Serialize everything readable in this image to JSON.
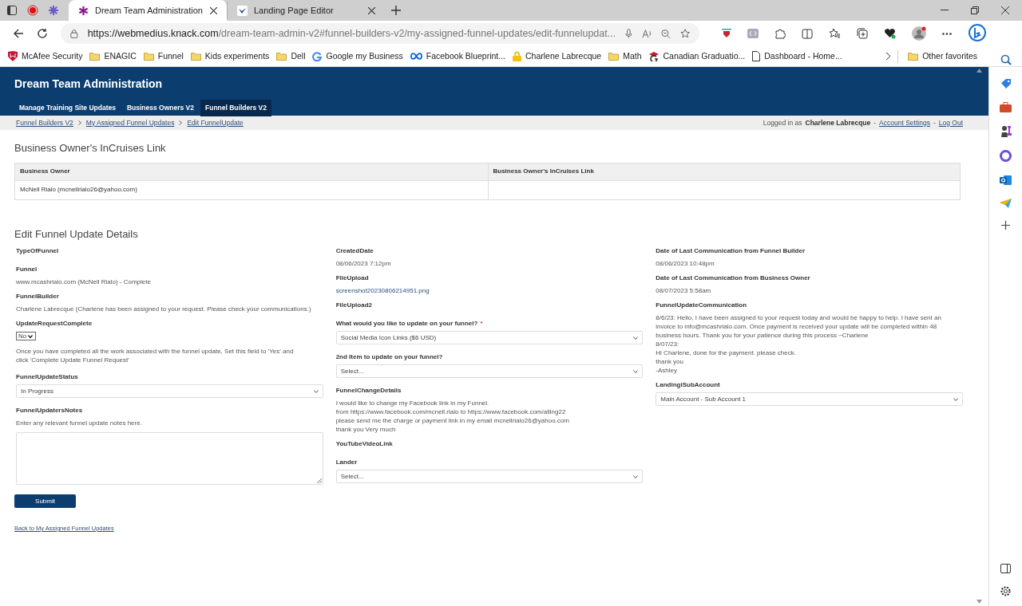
{
  "browser": {
    "tabs": [
      {
        "label": "Dream Team Administration",
        "selected": true
      },
      {
        "label": "Landing Page Editor",
        "selected": false
      }
    ],
    "url_host": "https://webmedius.knack.com",
    "url_path": "/dream-team-admin-v2#funnel-builders-v2/my-assigned-funnel-updates/edit-funnelupdat...",
    "bookmarks": [
      {
        "label": "McAfee Security",
        "kind": "shield"
      },
      {
        "label": "ENAGIC",
        "kind": "folder"
      },
      {
        "label": "Funnel",
        "kind": "folder"
      },
      {
        "label": "Kids experiments",
        "kind": "folder"
      },
      {
        "label": "Dell",
        "kind": "folder"
      },
      {
        "label": "Google my Business",
        "kind": "google"
      },
      {
        "label": "Facebook Blueprint...",
        "kind": "meta"
      },
      {
        "label": "Charlene Labrecque",
        "kind": "lock"
      },
      {
        "label": "Math",
        "kind": "folder"
      },
      {
        "label": "Canadian Graduatio...",
        "kind": "cap"
      },
      {
        "label": "Dashboard - Home...",
        "kind": "page"
      }
    ],
    "other_favorites": "Other favorites"
  },
  "app": {
    "title": "Dream Team Administration",
    "nav": [
      {
        "label": "Manage Training Site Updates",
        "selected": false
      },
      {
        "label": "Business Owners V2",
        "selected": false
      },
      {
        "label": "Funnel Builders V2",
        "selected": true
      }
    ],
    "breadcrumbs": [
      "Funnel Builders V2",
      "My Assigned Funnel Updates",
      "Edit FunnelUpdate"
    ],
    "login": {
      "prefix": "Logged in as",
      "user": "Charlene Labrecque",
      "separator": "-",
      "links": [
        "Account Settings",
        "Log Out"
      ]
    }
  },
  "owner_section": {
    "title": "Business Owner's InCruises Link",
    "columns": [
      "Business Owner",
      "Business Owner's InCruises Link"
    ],
    "rows": [
      [
        "McNell Rialo (mcnellrialo26@yahoo.com)"
      ]
    ]
  },
  "form": {
    "title": "Edit Funnel Update Details",
    "columns": [
      [
        {
          "kind": "label",
          "label": "TypeOfFunnel"
        },
        {
          "kind": "text",
          "label": "Funnel",
          "value": "www.mcashrialo.com (McNell Rialo) - Complete"
        },
        {
          "kind": "text",
          "label": "FunnelBuilder",
          "value": "Charlene Labrecque (Charlene has been assigned to your request. Please check your communications.)"
        },
        {
          "kind": "small-select",
          "label": "UpdateRequestComplete",
          "value": "No",
          "hint": "Once you have completed all the work associated with the funnel update, Set this field to 'Yes' and click 'Complete Update Funnel Request'"
        },
        {
          "kind": "select",
          "label": "FunnelUpdateStatus",
          "value": "In Progress"
        },
        {
          "kind": "textarea",
          "label": "FunnelUpdatersNotes",
          "hint": "Enter any relevant funnel update notes here."
        }
      ],
      [
        {
          "kind": "text",
          "label": "CreatedDate",
          "value": "08/06/2023 7:12pm"
        },
        {
          "kind": "link",
          "label": "FileUpload",
          "value": "screenshot20230806214951.png"
        },
        {
          "kind": "label",
          "label": "FileUpload2"
        },
        {
          "kind": "select",
          "label": "What would you like to update on your funnel?",
          "required": true,
          "value": "Social Media Icon Links ($6 USD)"
        },
        {
          "kind": "select",
          "label": "2nd Item to update on your funnel?",
          "value": "Select..."
        },
        {
          "kind": "lines",
          "label": "FunnelChangeDetails",
          "lines": [
            "I would like to change my Facebook link in my Funnel.",
            "from https://www.facebook.com/mcnell.rialo to https://www.facebook.com/alling22",
            "please send me the charge or payment link in my email mcnellrialo26@yahoo.com",
            "thank you Very much"
          ]
        },
        {
          "kind": "label",
          "label": "YouTubeVideoLink"
        },
        {
          "kind": "select",
          "label": "Lander",
          "value": "Select..."
        }
      ],
      [
        {
          "kind": "text",
          "label": "Date of Last Communication from Funnel Builder",
          "value": "08/06/2023 10:48pm"
        },
        {
          "kind": "text",
          "label": "Date of Last Communication from Business Owner",
          "value": "08/07/2023 5:58am"
        },
        {
          "kind": "lines",
          "label": "FunnelUpdateCommunication",
          "lines": [
            "8/6/23: Hello, I have been assigned to your request today and would be happy to help. I have sent an invoice to info@mcashrialo.com. Once payment is received your update will be completed within 48 business hours. Thank you for your patience during this process ~Charlene",
            "8/07/23:",
            "Hi Charlene, done for the payment. please check.",
            "thank you",
            "-Ashley"
          ]
        },
        {
          "kind": "select",
          "label": "LandingiSubAccount",
          "value": "Main Account - Sub Account 1"
        }
      ]
    ],
    "required_mark": "*",
    "submit": "Submit",
    "back_link": "Back to My Assigned Funnel Updates"
  }
}
